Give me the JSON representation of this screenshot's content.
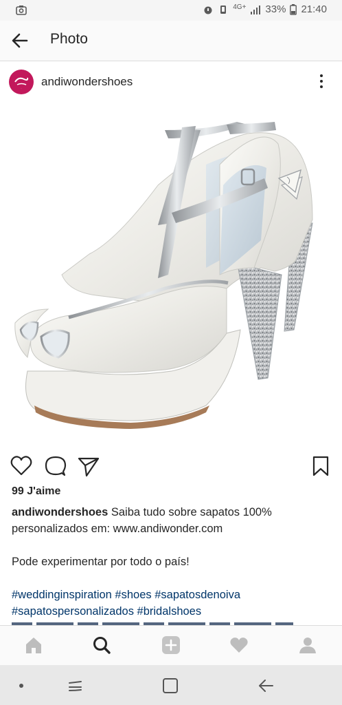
{
  "status_bar": {
    "network": "4G+",
    "battery": "33%",
    "time": "21:40"
  },
  "app_bar": {
    "title": "Photo"
  },
  "post": {
    "username": "andiwondershoes",
    "likes": "99 J'aime",
    "caption_user": "andiwondershoes",
    "caption_text": " Saiba tudo sobre sapatos 100% personalizados em: www.andiwonder.com",
    "caption_line2": "Pode experimentar por todo o país!",
    "hashtags_line1": "#weddinginspiration #shoes #sapatosdenoiva",
    "hashtags_line2": "#sapatospersonalizados #bridalshoes"
  },
  "icons": {
    "back": "arrow-left-icon",
    "more": "more-vertical-icon",
    "like": "heart-outline-icon",
    "comment": "comment-icon",
    "share": "send-icon",
    "save": "bookmark-icon",
    "nav": [
      "home-icon",
      "search-icon",
      "add-icon",
      "heart-icon",
      "profile-icon"
    ]
  },
  "colors": {
    "hashtag": "#003569",
    "avatar": "#c2185b",
    "nav_active": "#262626",
    "nav_inactive": "#bdbdbd"
  }
}
